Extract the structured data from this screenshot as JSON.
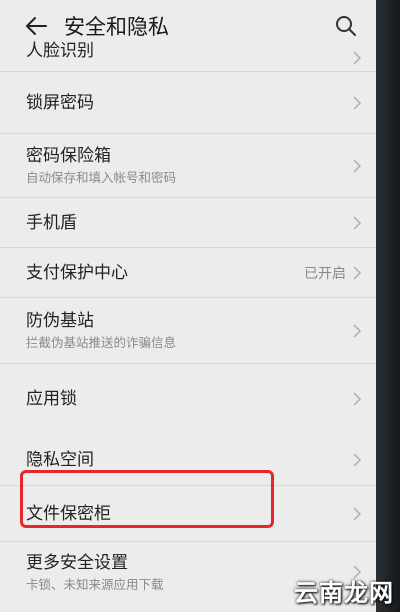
{
  "header": {
    "title": "安全和隐私"
  },
  "list": [
    {
      "label": "人脸识别",
      "sub": "",
      "status": ""
    },
    {
      "label": "锁屏密码",
      "sub": "",
      "status": ""
    },
    {
      "label": "密码保险箱",
      "sub": "自动保存和填入帐号和密码",
      "status": ""
    },
    {
      "label": "手机盾",
      "sub": "",
      "status": ""
    },
    {
      "label": "支付保护中心",
      "sub": "",
      "status": "已开启"
    },
    {
      "label": "防伪基站",
      "sub": "拦截伪基站推送的诈骗信息",
      "status": ""
    },
    {
      "label": "应用锁",
      "sub": "",
      "status": ""
    },
    {
      "label": "隐私空间",
      "sub": "",
      "status": ""
    },
    {
      "label": "文件保密柜",
      "sub": "",
      "status": ""
    },
    {
      "label": "更多安全设置",
      "sub": "卡锁、未知来源应用下载",
      "status": ""
    }
  ],
  "highlight_color": "#e5272c",
  "watermark": "云南龙网"
}
